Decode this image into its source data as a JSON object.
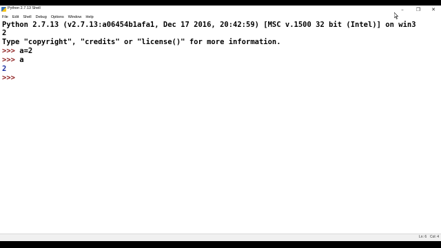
{
  "window": {
    "title": "Python 2.7.13 Shell",
    "controls": {
      "minimize": "–",
      "restore": "❐",
      "close": "✕"
    }
  },
  "menu": [
    "File",
    "Edit",
    "Shell",
    "Debug",
    "Options",
    "Window",
    "Help"
  ],
  "shell": {
    "banner_line1": "Python 2.7.13 (v2.7.13:a06454b1afa1, Dec 17 2016, 20:42:59) [MSC v.1500 32 bit (Intel)] on win3",
    "banner_line2": "2",
    "banner_line3": "Type \"copyright\", \"credits\" or \"license()\" for more information.",
    "prompt": ">>>",
    "input1": " a=2",
    "input2": " a",
    "output1": "2",
    "prompt_empty": ">>>"
  },
  "status": {
    "line": "Ln: 6",
    "col": "Col: 4"
  },
  "colors": {
    "prompt": "#8b1a1a",
    "output": "#1c2fa0",
    "text": "#000000"
  }
}
